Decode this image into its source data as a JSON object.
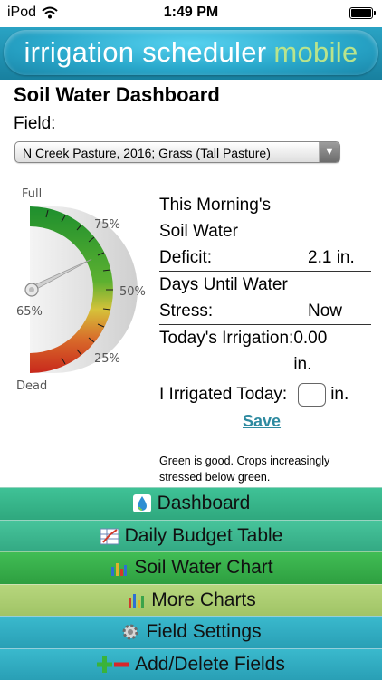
{
  "status_bar": {
    "carrier": "iPod",
    "time": "1:49 PM"
  },
  "header": {
    "brand_main": "irrigation scheduler",
    "brand_accent": "mobile"
  },
  "page": {
    "title": "Soil Water Dashboard",
    "field_label": "Field:",
    "field_selected": "N Creek Pasture, 2016; Grass (Tall Pasture)"
  },
  "gauge": {
    "labels": {
      "full": "Full",
      "p75": "75%",
      "p50": "50%",
      "p25": "25%",
      "dead": "Dead"
    },
    "value_label": "65%",
    "value_percent": 65
  },
  "stats": {
    "deficit_label": "Deficit:",
    "deficit_heading_1": "This Morning's",
    "deficit_heading_2": "Soil Water",
    "deficit_value": "2.1 in.",
    "days_heading": "Days Until Water",
    "stress_label": "Stress:",
    "stress_value": "Now",
    "irrigation_label": "Today's Irrigation:",
    "irrigation_value": "0.00",
    "irrigation_unit": "in.",
    "irrigated_today_label": "I Irrigated Today:",
    "irrigated_today_value": "",
    "irrigated_today_unit": "in.",
    "save_label": "Save",
    "footnote": "Green is good. Crops increasingly stressed below green."
  },
  "nav": [
    {
      "label": "Dashboard",
      "icon": "water-drop-icon"
    },
    {
      "label": "Daily Budget Table",
      "icon": "table-chart-icon"
    },
    {
      "label": "Soil Water Chart",
      "icon": "bar-chart-icon"
    },
    {
      "label": "More Charts",
      "icon": "bar-chart-icon"
    },
    {
      "label": "Field Settings",
      "icon": "gear-icon"
    },
    {
      "label": "Add/Delete Fields",
      "icon": "plus-minus-icon"
    }
  ],
  "colors": {
    "header": "#2aa9cc",
    "accent_green": "#b9e48c",
    "save_link": "#2e8aa0"
  }
}
